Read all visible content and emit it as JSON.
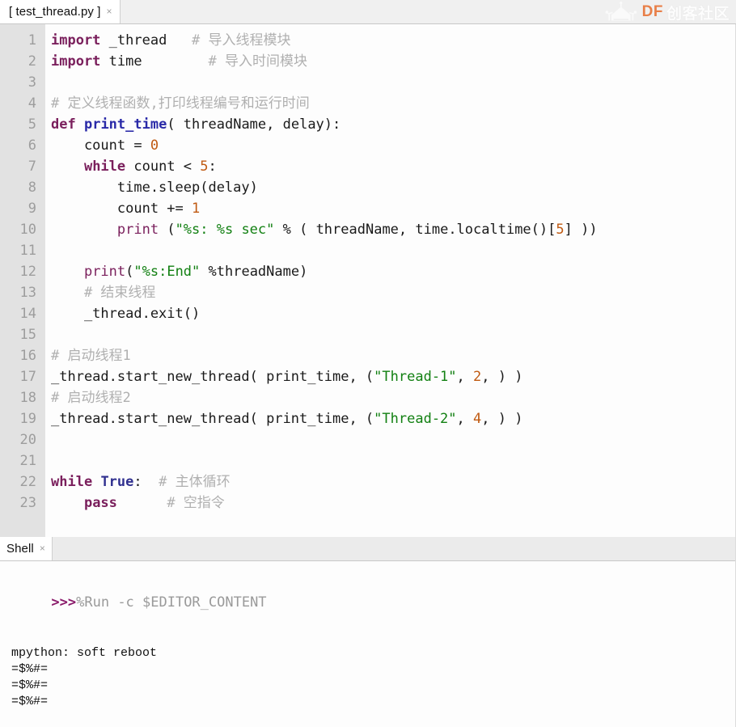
{
  "window": {
    "watermark": {
      "brand_latin": "DF",
      "brand_cn": "创客社区",
      "icon": "robot-logo-icon"
    }
  },
  "editor": {
    "tabs": [
      {
        "label": "[ test_thread.py ]",
        "close": "×",
        "active": true
      }
    ],
    "gutter": [
      "1",
      "2",
      "3",
      "4",
      "5",
      "6",
      "7",
      "8",
      "9",
      "10",
      "11",
      "12",
      "13",
      "14",
      "15",
      "16",
      "17",
      "18",
      "19",
      "20",
      "21",
      "22",
      "23"
    ],
    "lines": [
      {
        "n": "1",
        "tokens": [
          {
            "t": "import",
            "c": "kw"
          },
          {
            "t": " _thread",
            "c": "pl"
          },
          {
            "t": "   ",
            "c": "pl"
          },
          {
            "t": "# 导入线程模块",
            "c": "cmt"
          }
        ]
      },
      {
        "n": "2",
        "tokens": [
          {
            "t": "import",
            "c": "kw"
          },
          {
            "t": " time",
            "c": "pl"
          },
          {
            "t": "        ",
            "c": "pl"
          },
          {
            "t": "# 导入时间模块",
            "c": "cmt"
          }
        ]
      },
      {
        "n": "3",
        "tokens": []
      },
      {
        "n": "4",
        "tokens": [
          {
            "t": "# 定义线程函数,打印线程编号和运行时间",
            "c": "cmt"
          }
        ]
      },
      {
        "n": "5",
        "tokens": [
          {
            "t": "def",
            "c": "def"
          },
          {
            "t": " ",
            "c": "pl"
          },
          {
            "t": "print_time",
            "c": "fn"
          },
          {
            "t": "( threadName, delay):",
            "c": "pl"
          }
        ]
      },
      {
        "n": "6",
        "tokens": [
          {
            "t": "    count = ",
            "c": "pl"
          },
          {
            "t": "0",
            "c": "num"
          }
        ]
      },
      {
        "n": "7",
        "tokens": [
          {
            "t": "    ",
            "c": "pl"
          },
          {
            "t": "while",
            "c": "kw"
          },
          {
            "t": " count < ",
            "c": "pl"
          },
          {
            "t": "5",
            "c": "num"
          },
          {
            "t": ":",
            "c": "pl"
          }
        ]
      },
      {
        "n": "8",
        "tokens": [
          {
            "t": "        time.sleep(delay)",
            "c": "pl"
          }
        ]
      },
      {
        "n": "9",
        "tokens": [
          {
            "t": "        count += ",
            "c": "pl"
          },
          {
            "t": "1",
            "c": "num"
          }
        ]
      },
      {
        "n": "10",
        "tokens": [
          {
            "t": "        ",
            "c": "pl"
          },
          {
            "t": "print",
            "c": "bi"
          },
          {
            "t": " (",
            "c": "pl"
          },
          {
            "t": "\"%s: %s sec\"",
            "c": "str"
          },
          {
            "t": " % ( threadName, time.localtime()[",
            "c": "pl"
          },
          {
            "t": "5",
            "c": "num"
          },
          {
            "t": "] ))",
            "c": "pl"
          }
        ]
      },
      {
        "n": "11",
        "tokens": []
      },
      {
        "n": "12",
        "tokens": [
          {
            "t": "    ",
            "c": "pl"
          },
          {
            "t": "print",
            "c": "bi"
          },
          {
            "t": "(",
            "c": "pl"
          },
          {
            "t": "\"%s:End\"",
            "c": "str"
          },
          {
            "t": " %threadName)",
            "c": "pl"
          }
        ]
      },
      {
        "n": "13",
        "tokens": [
          {
            "t": "    ",
            "c": "pl"
          },
          {
            "t": "# 结束线程",
            "c": "cmt"
          }
        ]
      },
      {
        "n": "14",
        "tokens": [
          {
            "t": "    _thread.exit()",
            "c": "pl"
          }
        ]
      },
      {
        "n": "15",
        "tokens": []
      },
      {
        "n": "16",
        "tokens": [
          {
            "t": "# 启动线程1",
            "c": "cmt"
          }
        ]
      },
      {
        "n": "17",
        "tokens": [
          {
            "t": "_thread.start_new_thread( print_time, (",
            "c": "pl"
          },
          {
            "t": "\"Thread-1\"",
            "c": "str"
          },
          {
            "t": ", ",
            "c": "pl"
          },
          {
            "t": "2",
            "c": "num"
          },
          {
            "t": ", ) )",
            "c": "pl"
          }
        ]
      },
      {
        "n": "18",
        "tokens": [
          {
            "t": "# 启动线程2",
            "c": "cmt"
          }
        ]
      },
      {
        "n": "19",
        "tokens": [
          {
            "t": "_thread.start_new_thread( print_time, (",
            "c": "pl"
          },
          {
            "t": "\"Thread-2\"",
            "c": "str"
          },
          {
            "t": ", ",
            "c": "pl"
          },
          {
            "t": "4",
            "c": "num"
          },
          {
            "t": ", ) )",
            "c": "pl"
          }
        ]
      },
      {
        "n": "20",
        "tokens": []
      },
      {
        "n": "21",
        "tokens": []
      },
      {
        "n": "22",
        "tokens": [
          {
            "t": "while",
            "c": "kw"
          },
          {
            "t": " ",
            "c": "pl"
          },
          {
            "t": "True",
            "c": "bool"
          },
          {
            "t": ":",
            "c": "pl"
          },
          {
            "t": "  ",
            "c": "pl"
          },
          {
            "t": "# 主体循环",
            "c": "cmt"
          }
        ]
      },
      {
        "n": "23",
        "tokens": [
          {
            "t": "    ",
            "c": "pl"
          },
          {
            "t": "pass",
            "c": "kw"
          },
          {
            "t": "      ",
            "c": "pl"
          },
          {
            "t": "# 空指令",
            "c": "cmt"
          }
        ]
      }
    ]
  },
  "shell": {
    "tabs": [
      {
        "label": "Shell",
        "close": "×",
        "active": true
      }
    ],
    "prompt": ">>>",
    "command": "%Run -c $EDITOR_CONTENT",
    "output": [
      "mpython: soft reboot",
      "=$%#=",
      "=$%#=",
      "=$%#="
    ]
  }
}
